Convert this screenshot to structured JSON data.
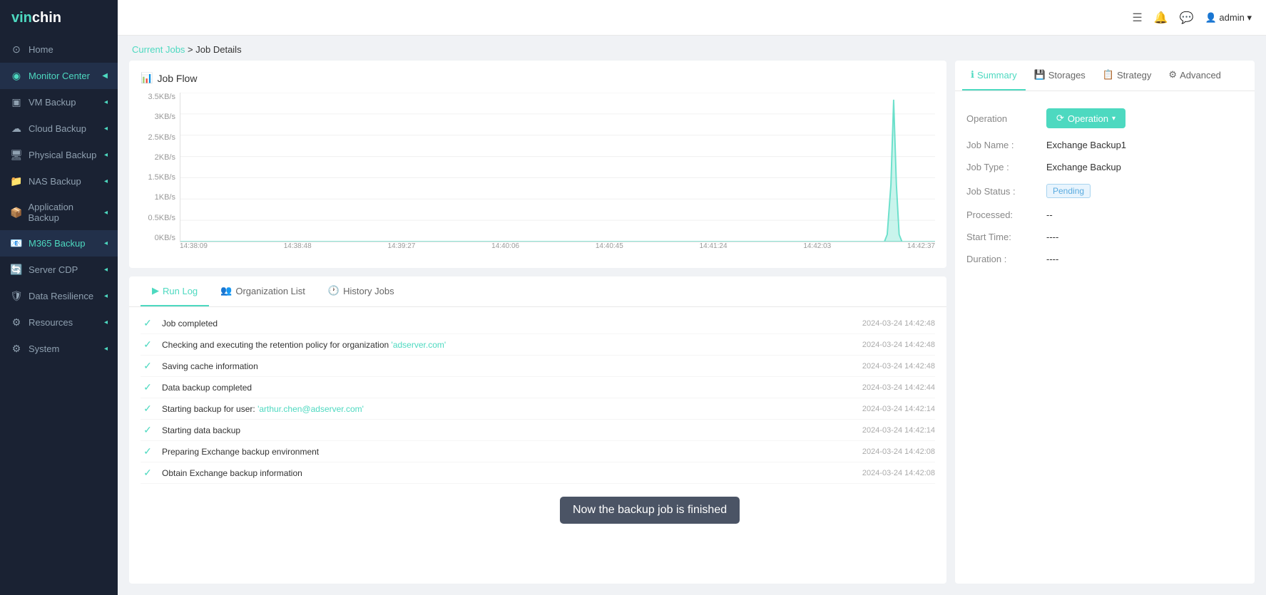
{
  "app": {
    "logo": "vinchin",
    "logo_color": "vin",
    "logo_white": "chin"
  },
  "topbar": {
    "user": "admin",
    "user_chevron": "▾"
  },
  "sidebar": {
    "items": [
      {
        "id": "home",
        "label": "Home",
        "icon": "⊙",
        "active": false
      },
      {
        "id": "monitor-center",
        "label": "Monitor Center",
        "icon": "◉",
        "active": true,
        "has_chevron": true
      },
      {
        "id": "vm-backup",
        "label": "VM Backup",
        "icon": "▣",
        "active": false,
        "has_chevron": true
      },
      {
        "id": "cloud-backup",
        "label": "Cloud Backup",
        "icon": "☁",
        "active": false,
        "has_chevron": true
      },
      {
        "id": "physical-backup",
        "label": "Physical Backup",
        "icon": "🖥",
        "active": false,
        "has_chevron": true
      },
      {
        "id": "nas-backup",
        "label": "NAS Backup",
        "icon": "📁",
        "active": false,
        "has_chevron": true
      },
      {
        "id": "application-backup",
        "label": "Application Backup",
        "icon": "📦",
        "active": false,
        "has_chevron": true
      },
      {
        "id": "m365-backup",
        "label": "M365 Backup",
        "icon": "📧",
        "active": true,
        "has_chevron": true
      },
      {
        "id": "server-cdp",
        "label": "Server CDP",
        "icon": "🔄",
        "active": false,
        "has_chevron": true
      },
      {
        "id": "data-resilience",
        "label": "Data Resilience",
        "icon": "🛡",
        "active": false,
        "has_chevron": true
      },
      {
        "id": "resources",
        "label": "Resources",
        "icon": "⚙",
        "active": false,
        "has_chevron": true
      },
      {
        "id": "system",
        "label": "System",
        "icon": "⚙",
        "active": false,
        "has_chevron": true
      }
    ]
  },
  "breadcrumb": {
    "parent": "Current Jobs",
    "separator": ">",
    "current": "Job Details"
  },
  "chart": {
    "title": "Job Flow",
    "title_icon": "📊",
    "yaxis": [
      "3.5KB/s",
      "3KB/s",
      "2.5KB/s",
      "2KB/s",
      "1.5KB/s",
      "1KB/s",
      "0.5KB/s",
      "0KB/s"
    ],
    "xaxis": [
      "14:38:09",
      "14:38:48",
      "14:39:27",
      "14:40:06",
      "14:40:45",
      "14:41:24",
      "14:42:03",
      "14:42:37"
    ]
  },
  "tabs": {
    "items": [
      {
        "id": "run-log",
        "label": "Run Log",
        "icon": "▶",
        "active": true
      },
      {
        "id": "org-list",
        "label": "Organization List",
        "icon": "👥",
        "active": false
      },
      {
        "id": "history-jobs",
        "label": "History Jobs",
        "icon": "🕐",
        "active": false
      }
    ]
  },
  "logs": [
    {
      "text": "Job completed",
      "time": "2024-03-24 14:42:48",
      "link": null
    },
    {
      "text": "Checking and executing the retention policy for organization ",
      "link_text": "'adserver.com'",
      "time": "2024-03-24 14:42:48",
      "link": true
    },
    {
      "text": "Saving cache information",
      "time": "2024-03-24 14:42:48",
      "link": null
    },
    {
      "text": "Data backup completed",
      "time": "2024-03-24 14:42:44",
      "link": null
    },
    {
      "text": "Starting backup for user: ",
      "link_text": "'arthur.chen@adserver.com'",
      "time": "2024-03-24 14:42:14",
      "link": true
    },
    {
      "text": "Starting data backup",
      "time": "2024-03-24 14:42:14",
      "link": null
    },
    {
      "text": "Preparing Exchange backup environment",
      "time": "2024-03-24 14:42:08",
      "link": null
    },
    {
      "text": "Obtain Exchange backup information",
      "time": "2024-03-24 14:42:08",
      "link": null
    }
  ],
  "right_panel": {
    "tabs": [
      {
        "id": "summary",
        "label": "Summary",
        "icon": "ℹ",
        "active": true
      },
      {
        "id": "storages",
        "label": "Storages",
        "icon": "💾",
        "active": false
      },
      {
        "id": "strategy",
        "label": "Strategy",
        "icon": "📋",
        "active": false
      },
      {
        "id": "advanced",
        "label": "Advanced",
        "icon": "⚙",
        "active": false
      }
    ],
    "operation_label": "Operation",
    "btn_operation": "Operation",
    "fields": [
      {
        "label": "Job Name :",
        "value": "Exchange Backup1",
        "type": "text"
      },
      {
        "label": "Job Type :",
        "value": "Exchange Backup",
        "type": "text"
      },
      {
        "label": "Job Status :",
        "value": "Pending",
        "type": "badge"
      },
      {
        "label": "Processed:",
        "value": "--",
        "type": "text"
      },
      {
        "label": "Start Time:",
        "value": "----",
        "type": "text"
      },
      {
        "label": "Duration :",
        "value": "----",
        "type": "text"
      }
    ]
  },
  "tooltip": {
    "text": "Now the backup job is finished"
  }
}
